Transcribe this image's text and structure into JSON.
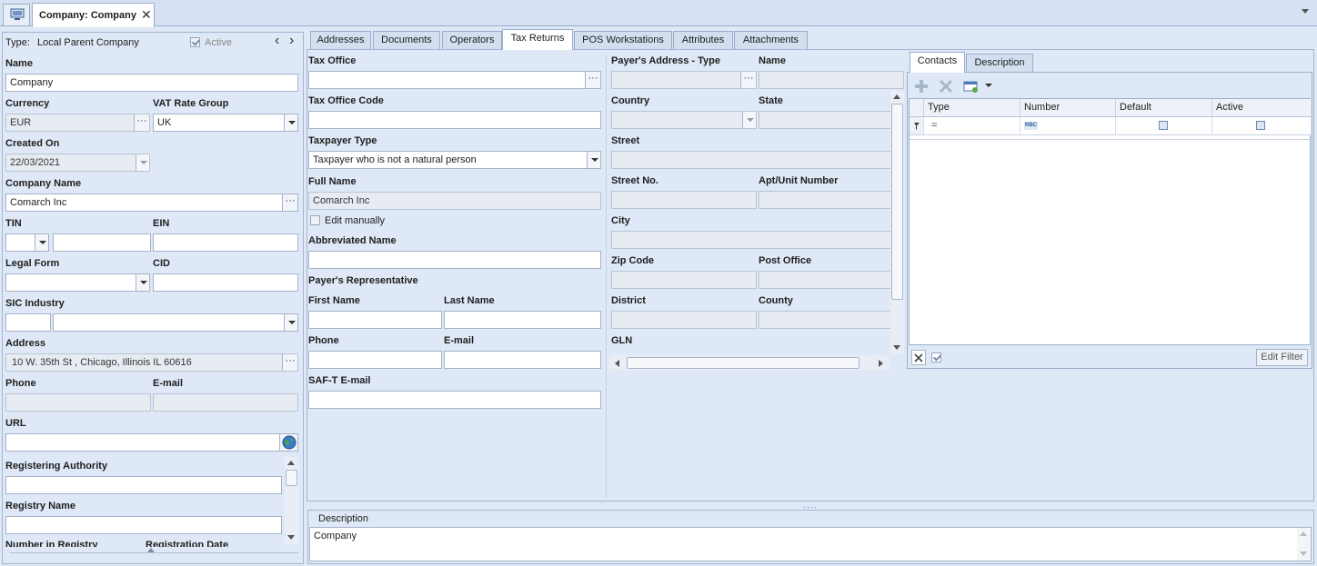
{
  "window": {
    "tab_title": "Company: Company",
    "close_glyph": "✕"
  },
  "left": {
    "type_label": "Type:",
    "type_value": "Local Parent Company",
    "active_label": "Active",
    "name_label": "Name",
    "name_value": "Company",
    "currency_label": "Currency",
    "currency_value": "EUR",
    "vat_label": "VAT Rate Group",
    "vat_value": "UK",
    "created_label": "Created On",
    "created_value": "22/03/2021",
    "company_name_label": "Company Name",
    "company_name_value": "Comarch Inc",
    "tin_label": "TIN",
    "ein_label": "EIN",
    "legal_form_label": "Legal Form",
    "cid_label": "CID",
    "sic_label": "SIC Industry",
    "address_label": "Address",
    "address_value": "10 W. 35th St , Chicago, Illinois IL 60616",
    "phone_label": "Phone",
    "email_label": "E-mail",
    "url_label": "URL",
    "reg_auth_label": "Registering Authority",
    "registry_name_label": "Registry Name",
    "number_registry_label": "Number in Registry",
    "registration_date_label": "Registration Date",
    "dots": "···",
    "nav_prev": "‹",
    "nav_next": "›"
  },
  "tabs": [
    {
      "label": "Addresses"
    },
    {
      "label": "Documents"
    },
    {
      "label": "Operators"
    },
    {
      "label": "Tax Returns"
    },
    {
      "label": "POS Workstations"
    },
    {
      "label": "Attributes"
    },
    {
      "label": "Attachments"
    }
  ],
  "tax": {
    "tax_office_label": "Tax Office",
    "tax_office_code_label": "Tax Office Code",
    "taxpayer_type_label": "Taxpayer Type",
    "taxpayer_type_value": "Taxpayer who is not a natural person",
    "full_name_label": "Full Name",
    "full_name_value": "Comarch Inc",
    "edit_manually_label": "Edit manually",
    "abbrev_label": "Abbreviated Name",
    "payer_rep_label": "Payer's Representative",
    "first_name_label": "First Name",
    "last_name_label": "Last Name",
    "phone_label": "Phone",
    "email_label": "E-mail",
    "saft_label": "SAF-T E-mail"
  },
  "payer": {
    "address_type_label": "Payer's Address - Type",
    "name_label": "Name",
    "country_label": "Country",
    "state_label": "State",
    "street_label": "Street",
    "street_no_label": "Street No.",
    "apt_label": "Apt/Unit Number",
    "city_label": "City",
    "zip_label": "Zip Code",
    "post_office_label": "Post Office",
    "district_label": "District",
    "county_label": "County",
    "gln_label": "GLN"
  },
  "contacts": {
    "tabs": [
      {
        "label": "Contacts"
      },
      {
        "label": "Description"
      }
    ],
    "columns": [
      {
        "label": "Type"
      },
      {
        "label": "Number"
      },
      {
        "label": "Default"
      },
      {
        "label": "Active"
      }
    ],
    "filter_row_type": "=",
    "filter_row_number": "RBC",
    "edit_filter_label": "Edit Filter"
  },
  "description": {
    "label": "Description",
    "value": "Company"
  }
}
